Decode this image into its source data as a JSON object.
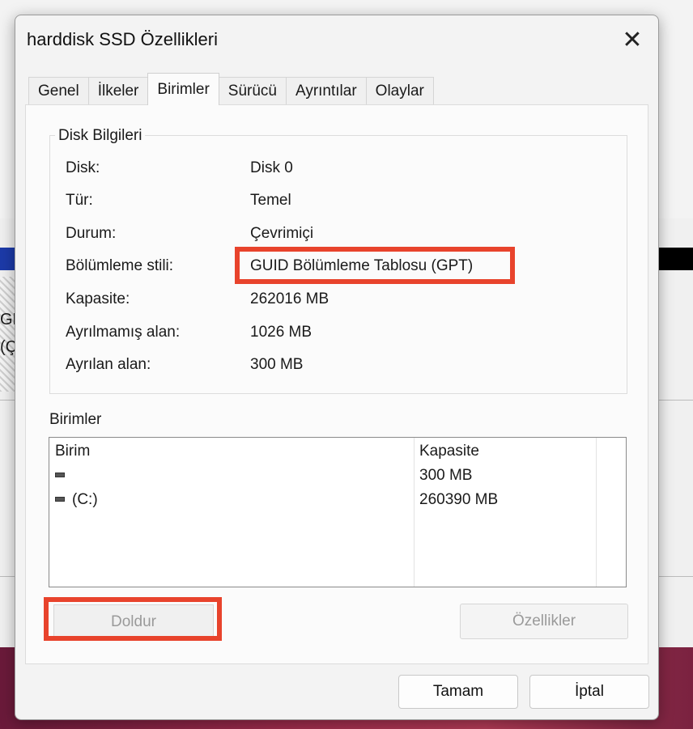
{
  "background": {
    "gb_fragment": "GB",
    "c_fragment": "(Ç"
  },
  "dialog": {
    "title": "harddisk SSD Özellikleri",
    "close_glyph": "✕",
    "tabs": [
      {
        "label": "Genel",
        "active": false
      },
      {
        "label": "İlkeler",
        "active": false
      },
      {
        "label": "Birimler",
        "active": true
      },
      {
        "label": "Sürücü",
        "active": false
      },
      {
        "label": "Ayrıntılar",
        "active": false
      },
      {
        "label": "Olaylar",
        "active": false
      }
    ],
    "disk_info": {
      "group_label": "Disk Bilgileri",
      "rows": [
        {
          "label": "Disk:",
          "value": "Disk 0"
        },
        {
          "label": "Tür:",
          "value": "Temel"
        },
        {
          "label": "Durum:",
          "value": "Çevrimiçi"
        },
        {
          "label": "Bölümleme stili:",
          "value": "GUID Bölümleme Tablosu (GPT)"
        },
        {
          "label": "Kapasite:",
          "value": "262016 MB"
        },
        {
          "label": "Ayrılmamış alan:",
          "value": "1026 MB"
        },
        {
          "label": "Ayrılan alan:",
          "value": "300 MB"
        }
      ]
    },
    "volumes": {
      "label": "Birimler",
      "headers": [
        "Birim",
        "Kapasite"
      ],
      "rows": [
        {
          "name": "",
          "capacity": "300 MB"
        },
        {
          "name": "(C:)",
          "capacity": "260390 MB"
        }
      ]
    },
    "buttons": {
      "fill": "Doldur",
      "properties": "Özellikler",
      "ok": "Tamam",
      "cancel": "İptal"
    },
    "highlight_color": "#e8432c"
  }
}
